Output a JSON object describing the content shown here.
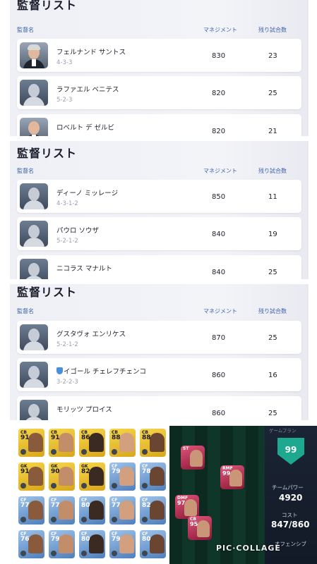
{
  "panels": [
    {
      "title": "監督リスト",
      "col_name": "監督名",
      "col_management": "マネジメント",
      "col_remaining": "残り試合数",
      "rows": [
        {
          "name": "フェルナンド サントス",
          "formation": "4-3-3",
          "management": "830",
          "remaining": "23"
        },
        {
          "name": "ラファエル ベニテス",
          "formation": "5-2-3",
          "management": "820",
          "remaining": "25"
        },
        {
          "name": "ロベルト デ ゼルビ",
          "formation": "",
          "management": "820",
          "remaining": "21"
        }
      ]
    },
    {
      "title": "監督リスト",
      "col_name": "監督名",
      "col_management": "マネジメント",
      "col_remaining": "残り試合数",
      "rows": [
        {
          "name": "ディーノ ミッレージ",
          "formation": "4-3-1-2",
          "management": "850",
          "remaining": "11"
        },
        {
          "name": "パウロ ソウザ",
          "formation": "5-2-1-2",
          "management": "840",
          "remaining": "19"
        },
        {
          "name": "ニコラス マナルト",
          "formation": "",
          "management": "840",
          "remaining": "25"
        }
      ]
    },
    {
      "title": "監督リスト",
      "col_name": "監督名",
      "col_management": "マネジメント",
      "col_remaining": "残り試合数",
      "rows": [
        {
          "name": "グスタヴォ エンリケス",
          "formation": "5-2-1-2",
          "management": "870",
          "remaining": "25"
        },
        {
          "name": "イゴール チェレフチェンコ",
          "formation": "3-2-2-3",
          "management": "860",
          "remaining": "16"
        },
        {
          "name": "モリッツ プロイス",
          "formation": "",
          "management": "860",
          "remaining": "25"
        }
      ]
    }
  ],
  "squad_cards": [
    {
      "pos": "CB",
      "ovr": "91",
      "type": "gold"
    },
    {
      "pos": "CB",
      "ovr": "91",
      "type": "gold"
    },
    {
      "pos": "CB",
      "ovr": "86",
      "type": "gold"
    },
    {
      "pos": "CB",
      "ovr": "88",
      "type": "gold"
    },
    {
      "pos": "CB",
      "ovr": "88",
      "type": "gold"
    },
    {
      "pos": "GK",
      "ovr": "91",
      "type": "gold"
    },
    {
      "pos": "GK",
      "ovr": "90",
      "type": "gold"
    },
    {
      "pos": "GK",
      "ovr": "82",
      "type": "gold"
    },
    {
      "pos": "CF",
      "ovr": "79",
      "type": "blue"
    },
    {
      "pos": "CF",
      "ovr": "78",
      "type": "blue"
    },
    {
      "pos": "CF",
      "ovr": "77",
      "type": "blue"
    },
    {
      "pos": "CF",
      "ovr": "77",
      "type": "blue"
    },
    {
      "pos": "CF",
      "ovr": "80",
      "type": "blue"
    },
    {
      "pos": "CF",
      "ovr": "77",
      "type": "blue"
    },
    {
      "pos": "CF",
      "ovr": "82",
      "type": "blue"
    },
    {
      "pos": "CF",
      "ovr": "76",
      "type": "blue"
    },
    {
      "pos": "CF",
      "ovr": "79",
      "type": "blue"
    },
    {
      "pos": "CF",
      "ovr": "80",
      "type": "blue"
    },
    {
      "pos": "CF",
      "ovr": "79",
      "type": "blue"
    },
    {
      "pos": "CF",
      "ovr": "80",
      "type": "blue"
    }
  ],
  "pitch_cards": [
    {
      "pos": "ST",
      "ovr": ""
    },
    {
      "pos": "RMF",
      "ovr": "99"
    },
    {
      "pos": "DMF",
      "ovr": "97"
    },
    {
      "pos": "CB",
      "ovr": "95"
    }
  ],
  "stats": {
    "top_label": "ゲームプラン",
    "rating": "99",
    "team_power_label": "チームパワー",
    "team_power": "4920",
    "cost_label": "コスト",
    "cost": "847/860",
    "offense_label": "オフェンシブ"
  },
  "watermark": "PIC·COLLAGE"
}
